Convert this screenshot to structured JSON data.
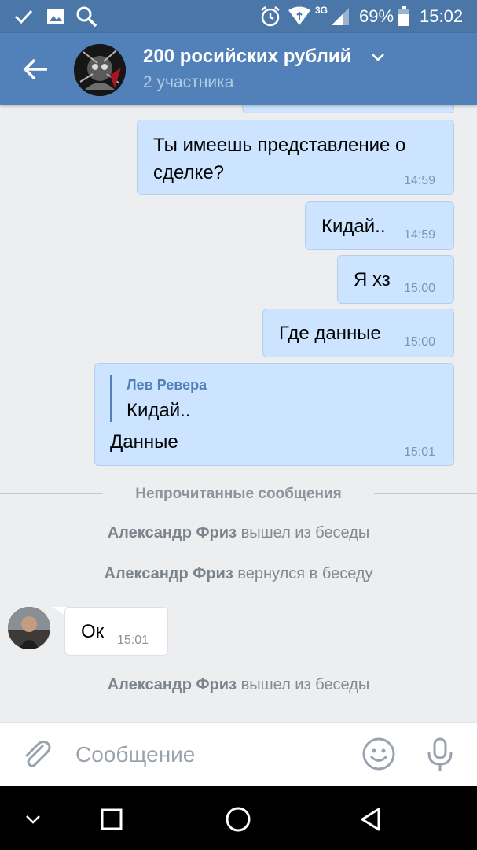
{
  "status_bar": {
    "battery": "69%",
    "network": "3G",
    "time": "15:02"
  },
  "header": {
    "title": "200 росийских рублий",
    "subtitle": "2 участника"
  },
  "messages": [
    {
      "text": "Ты имеешь представление о сделке?",
      "line1": "Ты имеешь представление о",
      "line2": "сделке?",
      "time": "14:59"
    },
    {
      "text": "Кидай..",
      "time": "14:59"
    },
    {
      "text": "Я хз",
      "time": "15:00"
    },
    {
      "text": "Где данные",
      "time": "15:00"
    },
    {
      "reply_author": "Лев Ревера",
      "reply_text": "Кидай..",
      "text": "Данные",
      "time": "15:01"
    }
  ],
  "unread_divider": "Непрочитанные сообщения",
  "service_messages": [
    {
      "name": "Александр Фриз",
      "action": "вышел из беседы"
    },
    {
      "name": "Александр Фриз",
      "action": "вернулся в беседу"
    },
    {
      "name": "Александр Фриз",
      "action": "вышел из беседы"
    }
  ],
  "incoming": {
    "text": "Ок",
    "time": "15:01"
  },
  "composer": {
    "placeholder": "Сообщение"
  },
  "colors": {
    "header": "#5181b8",
    "status_bar": "#4a76a8",
    "outgoing_bubble": "#cce4ff",
    "background": "#edeef0"
  }
}
